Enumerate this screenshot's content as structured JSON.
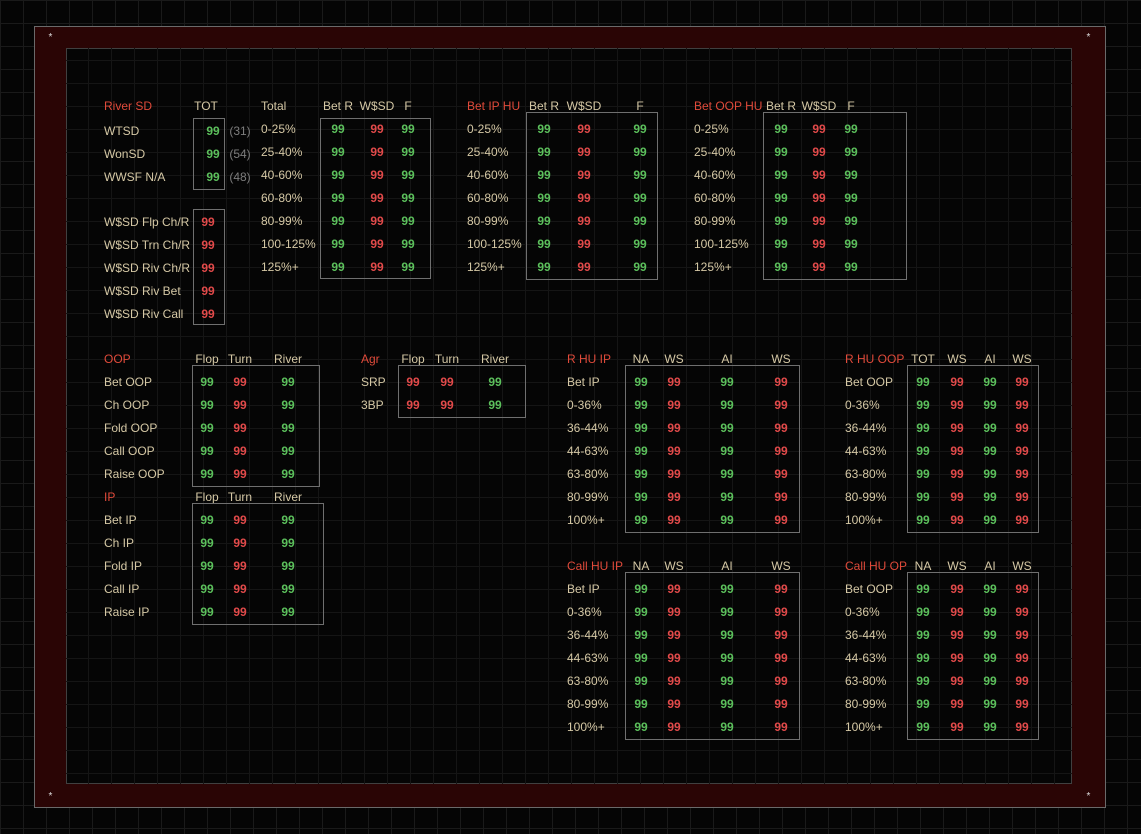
{
  "colors": {
    "accent_red": "#e04a3a",
    "value_green": "#5cc05c",
    "value_red": "#e24a4a",
    "label": "#d5c8a5",
    "frame_band": "#2a0505"
  },
  "decor": {
    "star": "*"
  },
  "river_sd": {
    "title": "River SD",
    "tot_header": "TOT",
    "rows": [
      {
        "label": "WTSD",
        "value": "99",
        "count": "(31)"
      },
      {
        "label": "WonSD",
        "value": "99",
        "count": "(54)"
      },
      {
        "label": "WWSF N/A",
        "value": "99",
        "count": "(48)"
      }
    ],
    "wsd_rows": [
      {
        "label": "W$SD Flp Ch/R",
        "value": "99"
      },
      {
        "label": "W$SD Trn Ch/R",
        "value": "99"
      },
      {
        "label": "W$SD Riv Ch/R",
        "value": "99"
      },
      {
        "label": "W$SD Riv Bet",
        "value": "99"
      },
      {
        "label": "W$SD Riv Call",
        "value": "99"
      }
    ]
  },
  "total_table": {
    "headers": [
      "Total",
      "Bet R",
      "W$SD",
      "F"
    ],
    "rows": [
      {
        "label": "0-25%",
        "v": [
          "99",
          "99",
          "99"
        ]
      },
      {
        "label": "25-40%",
        "v": [
          "99",
          "99",
          "99"
        ]
      },
      {
        "label": "40-60%",
        "v": [
          "99",
          "99",
          "99"
        ]
      },
      {
        "label": "60-80%",
        "v": [
          "99",
          "99",
          "99"
        ]
      },
      {
        "label": "80-99%",
        "v": [
          "99",
          "99",
          "99"
        ]
      },
      {
        "label": "100-125%",
        "v": [
          "99",
          "99",
          "99"
        ]
      },
      {
        "label": "125%+",
        "v": [
          "99",
          "99",
          "99"
        ]
      }
    ]
  },
  "bet_ip_hu": {
    "headers": [
      "Bet IP HU",
      "Bet R",
      "W$SD",
      "F"
    ],
    "rows": [
      {
        "label": "0-25%",
        "v": [
          "99",
          "99",
          "99"
        ]
      },
      {
        "label": "25-40%",
        "v": [
          "99",
          "99",
          "99"
        ]
      },
      {
        "label": "40-60%",
        "v": [
          "99",
          "99",
          "99"
        ]
      },
      {
        "label": "60-80%",
        "v": [
          "99",
          "99",
          "99"
        ]
      },
      {
        "label": "80-99%",
        "v": [
          "99",
          "99",
          "99"
        ]
      },
      {
        "label": "100-125%",
        "v": [
          "99",
          "99",
          "99"
        ]
      },
      {
        "label": "125%+",
        "v": [
          "99",
          "99",
          "99"
        ]
      }
    ]
  },
  "bet_oop_hu": {
    "headers": [
      "Bet OOP HU",
      "Bet R",
      "W$SD",
      "F"
    ],
    "rows": [
      {
        "label": "0-25%",
        "v": [
          "99",
          "99",
          "99"
        ]
      },
      {
        "label": "25-40%",
        "v": [
          "99",
          "99",
          "99"
        ]
      },
      {
        "label": "40-60%",
        "v": [
          "99",
          "99",
          "99"
        ]
      },
      {
        "label": "60-80%",
        "v": [
          "99",
          "99",
          "99"
        ]
      },
      {
        "label": "80-99%",
        "v": [
          "99",
          "99",
          "99"
        ]
      },
      {
        "label": "100-125%",
        "v": [
          "99",
          "99",
          "99"
        ]
      },
      {
        "label": "125%+",
        "v": [
          "99",
          "99",
          "99"
        ]
      }
    ]
  },
  "oop": {
    "headers": [
      "OOP",
      "Flop",
      "Turn",
      "River"
    ],
    "rows": [
      {
        "label": "Bet OOP",
        "v": [
          "99",
          "99",
          "99"
        ]
      },
      {
        "label": "Ch OOP",
        "v": [
          "99",
          "99",
          "99"
        ]
      },
      {
        "label": "Fold OOP",
        "v": [
          "99",
          "99",
          "99"
        ]
      },
      {
        "label": "Call OOP",
        "v": [
          "99",
          "99",
          "99"
        ]
      },
      {
        "label": "Raise OOP",
        "v": [
          "99",
          "99",
          "99"
        ]
      }
    ]
  },
  "ip": {
    "headers": [
      "IP",
      "Flop",
      "Turn",
      "River"
    ],
    "rows": [
      {
        "label": "Bet IP",
        "v": [
          "99",
          "99",
          "99"
        ]
      },
      {
        "label": "Ch IP",
        "v": [
          "99",
          "99",
          "99"
        ]
      },
      {
        "label": "Fold IP",
        "v": [
          "99",
          "99",
          "99"
        ]
      },
      {
        "label": "Call IP",
        "v": [
          "99",
          "99",
          "99"
        ]
      },
      {
        "label": "Raise IP",
        "v": [
          "99",
          "99",
          "99"
        ]
      }
    ]
  },
  "agr": {
    "headers": [
      "Agr",
      "Flop",
      "Turn",
      "River"
    ],
    "rows": [
      {
        "label": "SRP",
        "v": [
          "99",
          "99",
          "99"
        ]
      },
      {
        "label": "3BP",
        "v": [
          "99",
          "99",
          "99"
        ]
      }
    ]
  },
  "r_hu_ip": {
    "headers": [
      "R HU IP",
      "NA",
      "WS",
      "AI",
      "WS"
    ],
    "rows": [
      {
        "label": "Bet IP",
        "v": [
          "99",
          "99",
          "99",
          "99"
        ]
      },
      {
        "label": "0-36%",
        "v": [
          "99",
          "99",
          "99",
          "99"
        ]
      },
      {
        "label": "36-44%",
        "v": [
          "99",
          "99",
          "99",
          "99"
        ]
      },
      {
        "label": "44-63%",
        "v": [
          "99",
          "99",
          "99",
          "99"
        ]
      },
      {
        "label": "63-80%",
        "v": [
          "99",
          "99",
          "99",
          "99"
        ]
      },
      {
        "label": "80-99%",
        "v": [
          "99",
          "99",
          "99",
          "99"
        ]
      },
      {
        "label": "100%+",
        "v": [
          "99",
          "99",
          "99",
          "99"
        ]
      }
    ]
  },
  "r_hu_oop": {
    "headers": [
      "R HU OOP",
      "TOT",
      "WS",
      "AI",
      "WS"
    ],
    "rows": [
      {
        "label": "Bet OOP",
        "v": [
          "99",
          "99",
          "99",
          "99"
        ]
      },
      {
        "label": "0-36%",
        "v": [
          "99",
          "99",
          "99",
          "99"
        ]
      },
      {
        "label": "36-44%",
        "v": [
          "99",
          "99",
          "99",
          "99"
        ]
      },
      {
        "label": "44-63%",
        "v": [
          "99",
          "99",
          "99",
          "99"
        ]
      },
      {
        "label": "63-80%",
        "v": [
          "99",
          "99",
          "99",
          "99"
        ]
      },
      {
        "label": "80-99%",
        "v": [
          "99",
          "99",
          "99",
          "99"
        ]
      },
      {
        "label": "100%+",
        "v": [
          "99",
          "99",
          "99",
          "99"
        ]
      }
    ]
  },
  "call_hu_ip": {
    "headers": [
      "Call HU IP",
      "NA",
      "WS",
      "AI",
      "WS"
    ],
    "rows": [
      {
        "label": "Bet IP",
        "v": [
          "99",
          "99",
          "99",
          "99"
        ]
      },
      {
        "label": "0-36%",
        "v": [
          "99",
          "99",
          "99",
          "99"
        ]
      },
      {
        "label": "36-44%",
        "v": [
          "99",
          "99",
          "99",
          "99"
        ]
      },
      {
        "label": "44-63%",
        "v": [
          "99",
          "99",
          "99",
          "99"
        ]
      },
      {
        "label": "63-80%",
        "v": [
          "99",
          "99",
          "99",
          "99"
        ]
      },
      {
        "label": "80-99%",
        "v": [
          "99",
          "99",
          "99",
          "99"
        ]
      },
      {
        "label": "100%+",
        "v": [
          "99",
          "99",
          "99",
          "99"
        ]
      }
    ]
  },
  "call_hu_op": {
    "headers": [
      "Call HU OP",
      "NA",
      "WS",
      "AI",
      "WS"
    ],
    "rows": [
      {
        "label": "Bet OOP",
        "v": [
          "99",
          "99",
          "99",
          "99"
        ]
      },
      {
        "label": "0-36%",
        "v": [
          "99",
          "99",
          "99",
          "99"
        ]
      },
      {
        "label": "36-44%",
        "v": [
          "99",
          "99",
          "99",
          "99"
        ]
      },
      {
        "label": "44-63%",
        "v": [
          "99",
          "99",
          "99",
          "99"
        ]
      },
      {
        "label": "63-80%",
        "v": [
          "99",
          "99",
          "99",
          "99"
        ]
      },
      {
        "label": "80-99%",
        "v": [
          "99",
          "99",
          "99",
          "99"
        ]
      },
      {
        "label": "100%+",
        "v": [
          "99",
          "99",
          "99",
          "99"
        ]
      }
    ]
  }
}
